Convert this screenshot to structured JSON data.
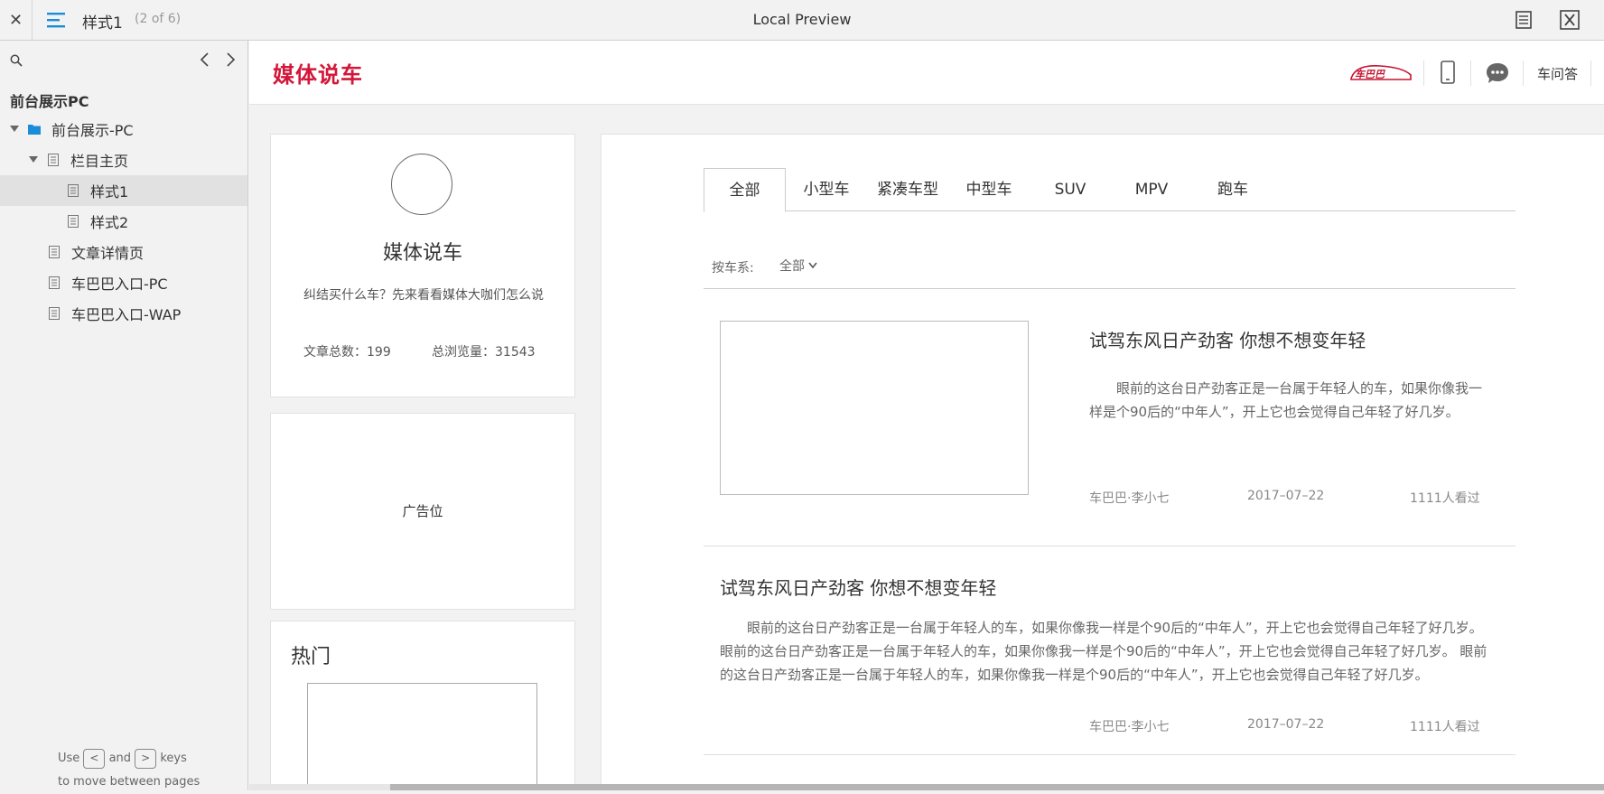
{
  "toolbar": {
    "page_name": "样式1",
    "page_count": "(2 of 6)",
    "title": "Local Preview"
  },
  "sidebar": {
    "project_title": "前台展示PC",
    "items": [
      {
        "label": "前台展示-PC",
        "type": "folder"
      },
      {
        "label": "栏目主页",
        "type": "page"
      },
      {
        "label": "样式1",
        "type": "page"
      },
      {
        "label": "样式2",
        "type": "page"
      },
      {
        "label": "文章详情页",
        "type": "page"
      },
      {
        "label": "车巴巴入口-PC",
        "type": "page"
      },
      {
        "label": "车巴巴入口-WAP",
        "type": "page"
      }
    ],
    "hint": {
      "use": "Use",
      "prev_key": "<",
      "and": "and",
      "next_key": ">",
      "keys": "keys",
      "line2": "to move between pages"
    }
  },
  "site": {
    "brand": "媒体说车",
    "logo_text": "车巴巴",
    "qa_link": "车问答",
    "colors": {
      "brand": "#d3173a",
      "logo": "#c8102e"
    }
  },
  "profile": {
    "name": "媒体说车",
    "description": "纠结买什么车？先来看看媒体大咖们怎么说",
    "articles": "文章总数：199",
    "views": "总浏览量：31543"
  },
  "ad": {
    "label": "广告位"
  },
  "hot": {
    "title": "热门"
  },
  "tabs": [
    "全部",
    "小型车",
    "紧凑车型",
    "中型车",
    "SUV",
    "MPV",
    "跑车"
  ],
  "filter": {
    "label": "按车系:",
    "value": "全部"
  },
  "articles": [
    {
      "title": "试驾东风日产劲客 你想不想变年轻",
      "excerpt": "眼前的这台日产劲客正是一台属于年轻人的车，如果你像我一样是个90后的“中年人”，开上它也会觉得自己年轻了好几岁。",
      "author": "车巴巴·李小七",
      "date": "2017–07–22",
      "views": "1111人看过"
    },
    {
      "title": "试驾东风日产劲客 你想不想变年轻",
      "excerpt": "眼前的这台日产劲客正是一台属于年轻人的车，如果你像我一样是个90后的“中年人”，开上它也会觉得自己年轻了好几岁。 眼前的这台日产劲客正是一台属于年轻人的车，如果你像我一样是个90后的“中年人”，开上它也会觉得自己年轻了好几岁。 眼前的这台日产劲客正是一台属于年轻人的车，如果你像我一样是个90后的“中年人”，开上它也会觉得自己年轻了好几岁。",
      "author": "车巴巴·李小七",
      "date": "2017–07–22",
      "views": "1111人看过"
    }
  ]
}
